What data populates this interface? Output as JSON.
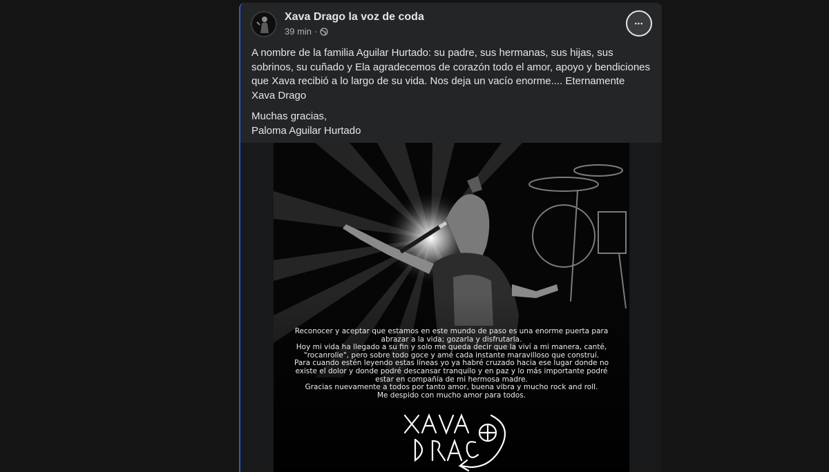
{
  "post": {
    "author": "Xava Drago la voz de coda",
    "time": "39 min",
    "globe_icon": "globe-icon",
    "more_icon": "more-dots-icon",
    "more_glyph": "•••",
    "paragraph1": "A nombre de la familia Aguilar Hurtado: su padre, sus hermanas, sus hijas, sus sobrinos, su cuñado y Ela agradecemos de corazón todo el amor, apoyo y bendiciones que Xava recibió a lo largo de su vida. Nos deja un vacío enorme.... Eternamente Xava Drago",
    "paragraph2_line1": "Muchas gracias,",
    "paragraph2_line2": "Paloma Aguilar Hurtado"
  },
  "image": {
    "tribute_lines": [
      "Reconocer y aceptar que estamos en este mundo de paso es una enorme puerta para",
      "abrazar a la vida; gozarla y disfrutarla.",
      "Hoy mi vida ha llegado a su fin y solo me queda decir que la viví a mi manera, canté,",
      "\"rocanrolie\", pero sobre todo goce y amé cada instante maravilloso que construí.",
      "Para cuando estén leyendo estas líneas yo ya habré cruzado hacia ese lugar donde no",
      "existe el dolor y donde podré descansar tranquilo y en paz y lo más importante podré",
      "estar en compañía de mi hermosa madre.",
      "Gracias nuevamente a todos por tanto amor, buena vibra y mucho rock and roll.",
      "Me despido con mucho amor para todos."
    ],
    "signature": "Xava Drago"
  },
  "colors": {
    "background": "#141414",
    "card": "#242526",
    "text_primary": "#e4e6eb",
    "text_secondary": "#b0b3b8",
    "accent": "#2d5bd6"
  }
}
